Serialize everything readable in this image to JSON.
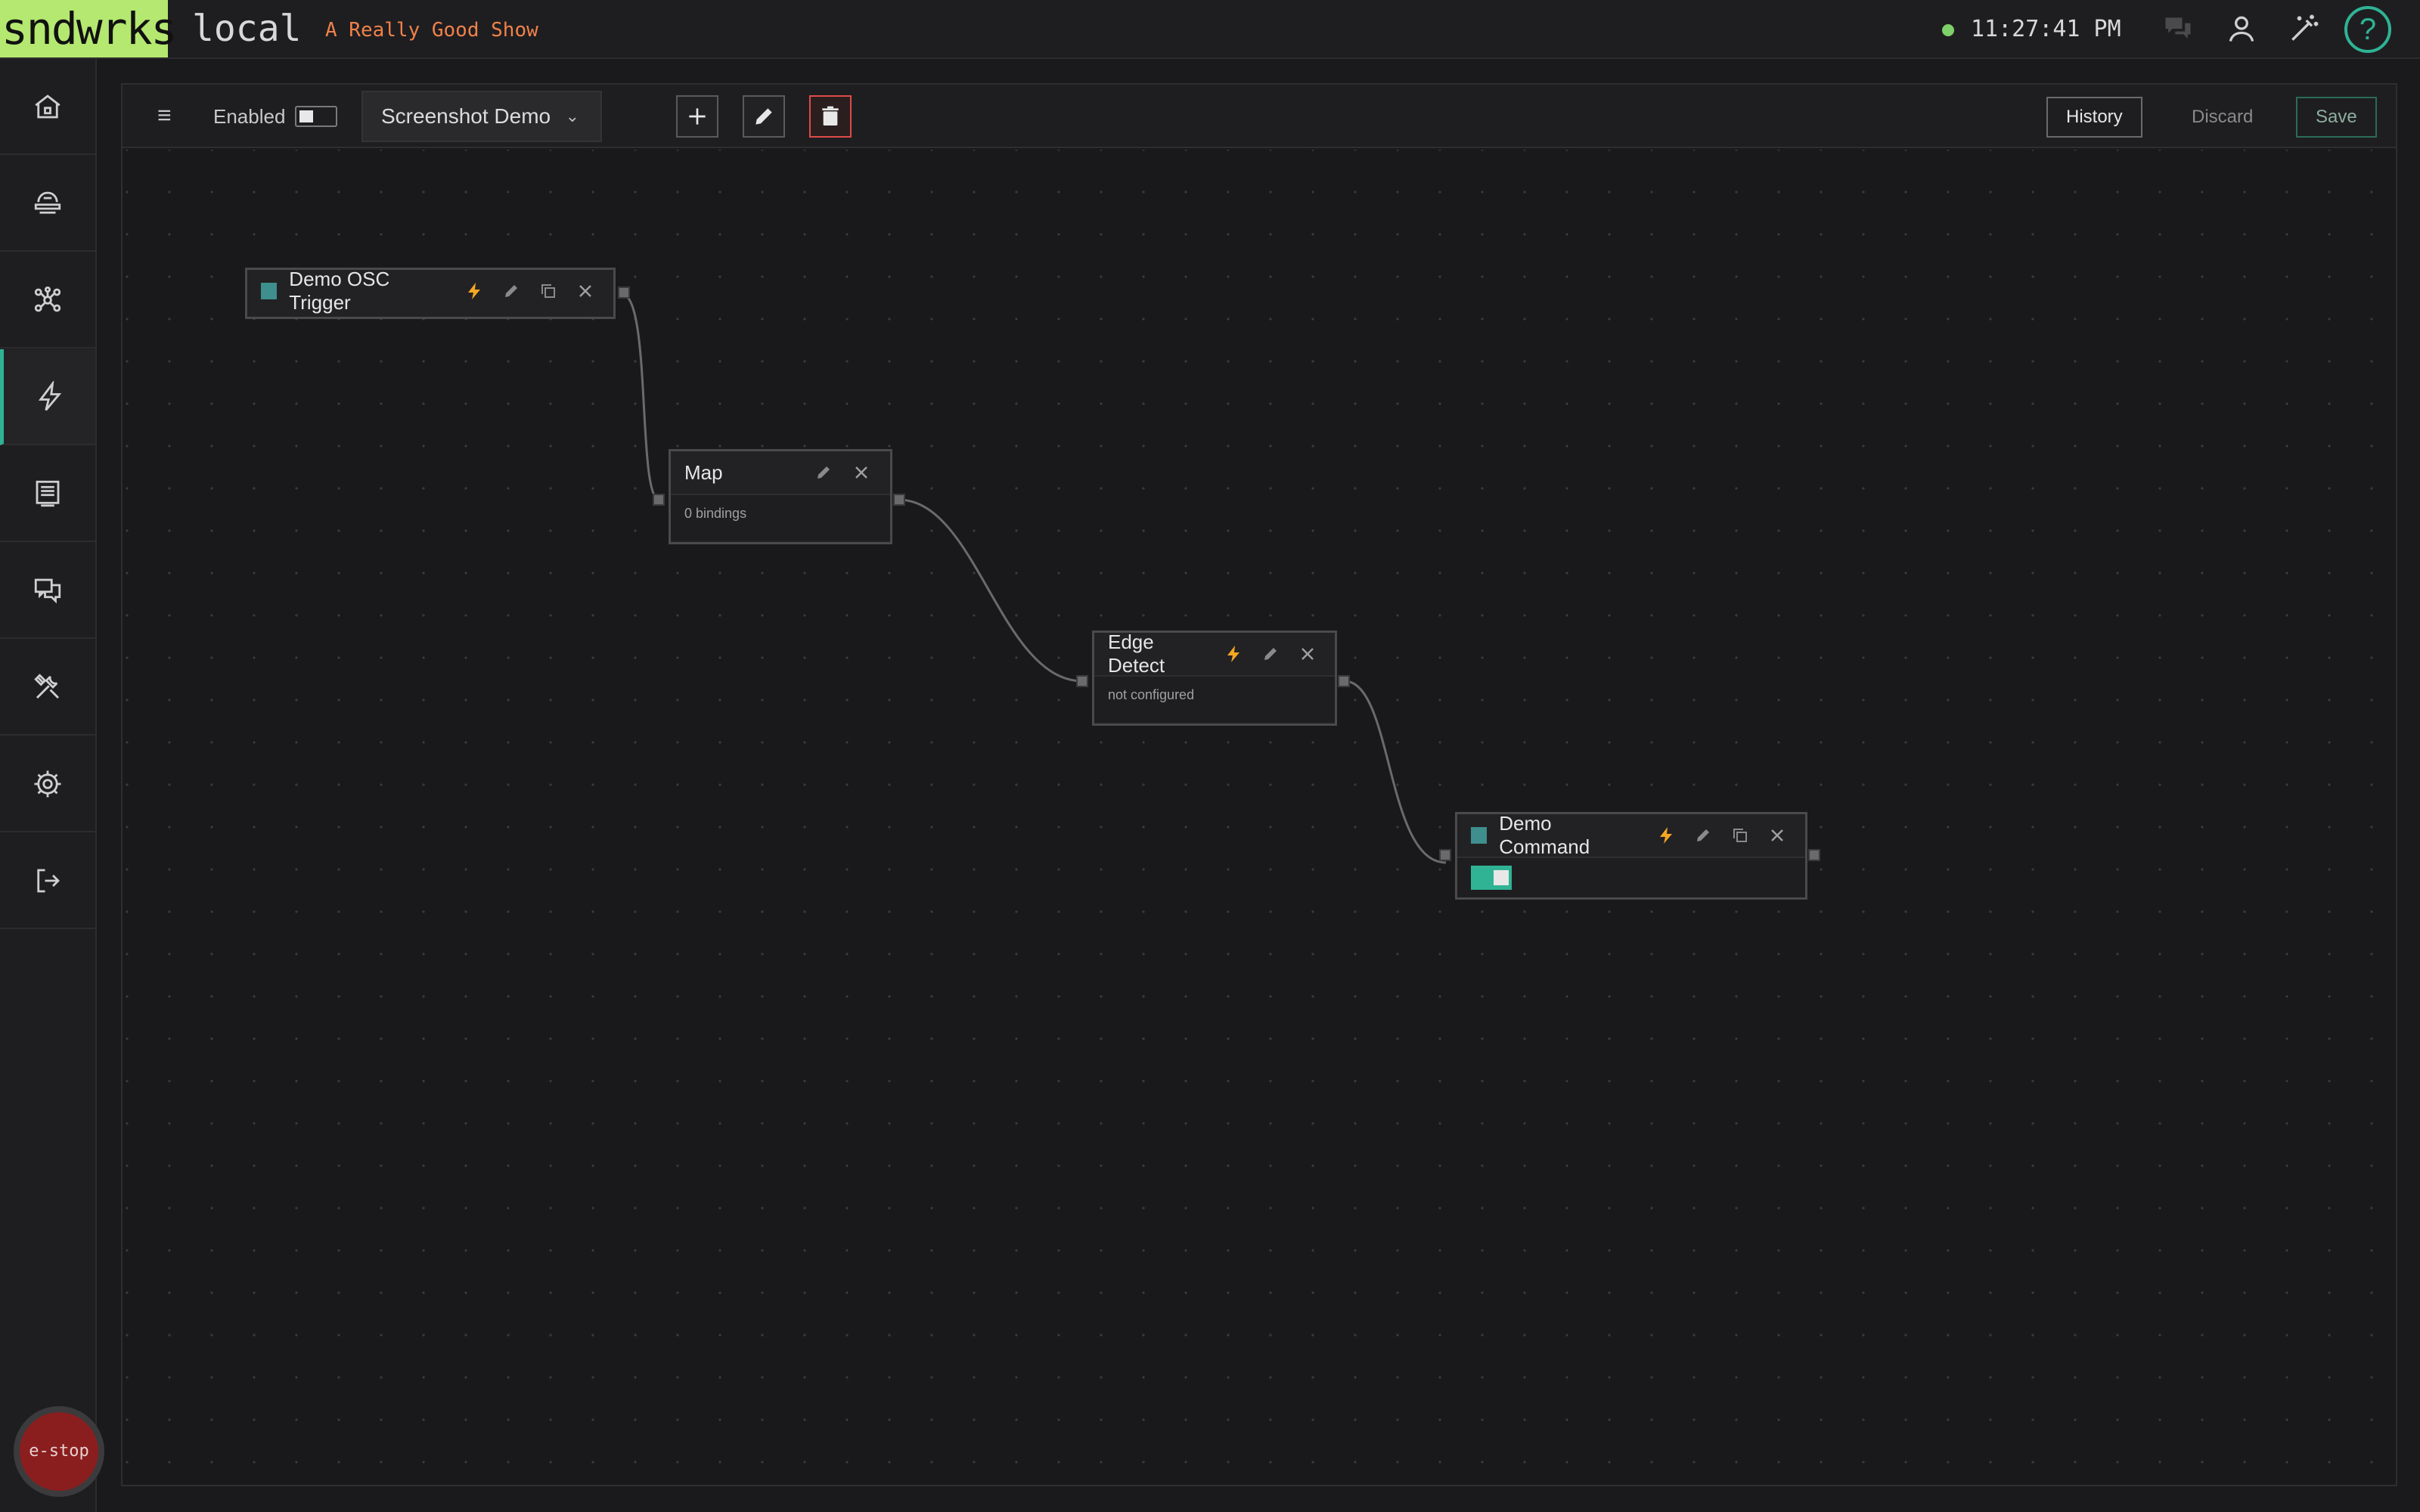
{
  "header": {
    "brand": "sndwrks",
    "instance": "local",
    "show": "A Really Good Show",
    "clock": "11:27:41 PM",
    "help": "?"
  },
  "sidebar": {
    "items": [
      {
        "icon": "home-icon"
      },
      {
        "icon": "devices-icon"
      },
      {
        "icon": "network-icon"
      },
      {
        "icon": "lightning-icon",
        "active": true
      },
      {
        "icon": "cue-list-icon"
      },
      {
        "icon": "chat-icon"
      },
      {
        "icon": "tools-icon"
      },
      {
        "icon": "gear-icon"
      },
      {
        "icon": "logout-icon"
      }
    ],
    "estop_label": "e-stop"
  },
  "toolbar": {
    "enabled_label": "Enabled",
    "enabled": false,
    "selected_flow": "Screenshot Demo",
    "history_label": "History",
    "discard_label": "Discard",
    "save_label": "Save"
  },
  "nodes": {
    "trigger": {
      "title": "Demo OSC Trigger"
    },
    "map": {
      "title": "Map",
      "detail": "0 bindings"
    },
    "edge": {
      "title": "Edge Detect",
      "detail": "not configured"
    },
    "command": {
      "title": "Demo Command",
      "toggle_on": true
    }
  },
  "colors": {
    "brand": "#b4e870",
    "accent": "#2fb394",
    "show_name": "#f0814a",
    "lightning": "#f5a623",
    "danger": "#e04a4a",
    "estop": "#8a1e1e",
    "node_swatch": "#3e8f8d"
  }
}
